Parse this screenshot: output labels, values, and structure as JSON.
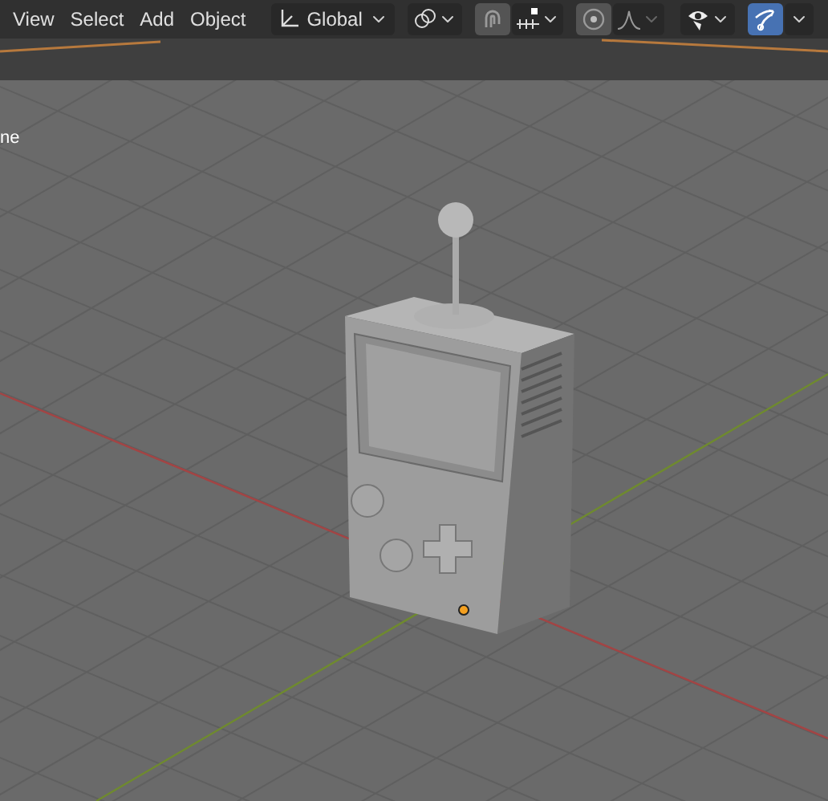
{
  "menu": [
    {
      "label": "View"
    },
    {
      "label": "Select"
    },
    {
      "label": "Add"
    },
    {
      "label": "Object"
    }
  ],
  "transform_orientation": {
    "label": "Global"
  },
  "toggles": [
    {
      "kind": "snap",
      "on": false
    },
    {
      "kind": "proportional",
      "on": false
    },
    {
      "kind": "gizmo",
      "on": true
    }
  ],
  "viewport": {
    "label": "ne"
  }
}
